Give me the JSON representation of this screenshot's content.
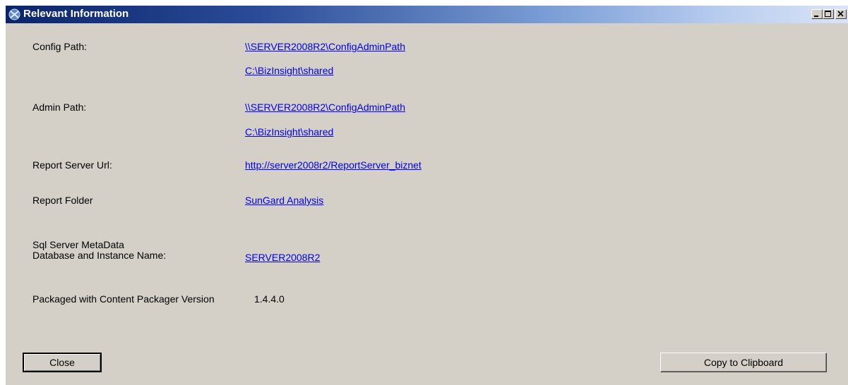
{
  "window": {
    "title": "Relevant Information"
  },
  "fields": {
    "config_path_label": "Config Path:",
    "config_path_link1": "\\\\SERVER2008R2\\ConfigAdminPath",
    "config_path_link2": "C:\\BizInsight\\shared",
    "admin_path_label": "Admin Path:",
    "admin_path_link1": "\\\\SERVER2008R2\\ConfigAdminPath",
    "admin_path_link2": "C:\\BizInsight\\shared",
    "report_server_label": "Report Server Url:",
    "report_server_link": "http://server2008r2/ReportServer_biznet",
    "report_folder_label": "Report Folder",
    "report_folder_link": "SunGard Analysis",
    "sql_label_line1": "Sql Server MetaData",
    "sql_label_line2": "Database and Instance Name:",
    "sql_link": "SERVER2008R2",
    "packaged_label": "Packaged with Content Packager Version",
    "packaged_version": "1.4.4.0"
  },
  "buttons": {
    "close": "Close",
    "copy": "Copy to Clipboard"
  },
  "colors": {
    "title_bar_start": "#0a246a",
    "link": "#0000ee",
    "dialog_bg": "#d4d0c8"
  }
}
